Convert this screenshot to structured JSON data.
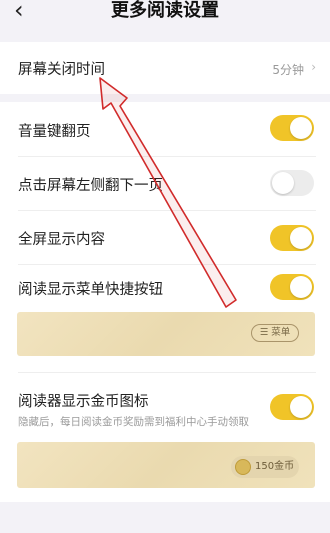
{
  "header": {
    "back_icon": "chevron-left-icon",
    "title": "更多阅读设置"
  },
  "screen_off": {
    "label": "屏幕关闭时间",
    "value": "5分钟"
  },
  "settings": [
    {
      "label": "音量键翻页",
      "on": true
    },
    {
      "label": "点击屏幕左侧翻下一页",
      "on": false
    },
    {
      "label": "全屏显示内容",
      "on": true
    },
    {
      "label": "阅读显示菜单快捷按钮",
      "on": true
    }
  ],
  "menu_preview": {
    "button_label": "☰ 菜单"
  },
  "coin_setting": {
    "label": "阅读器显示金币图标",
    "on": true,
    "description": "隐藏后，每日阅读金币奖励需到福利中心手动领取",
    "preview_badge": "150金币"
  },
  "colors": {
    "toggle_on": "#f0c428",
    "toggle_off": "#ececec",
    "annotation_arrow": "#d12b2b"
  }
}
